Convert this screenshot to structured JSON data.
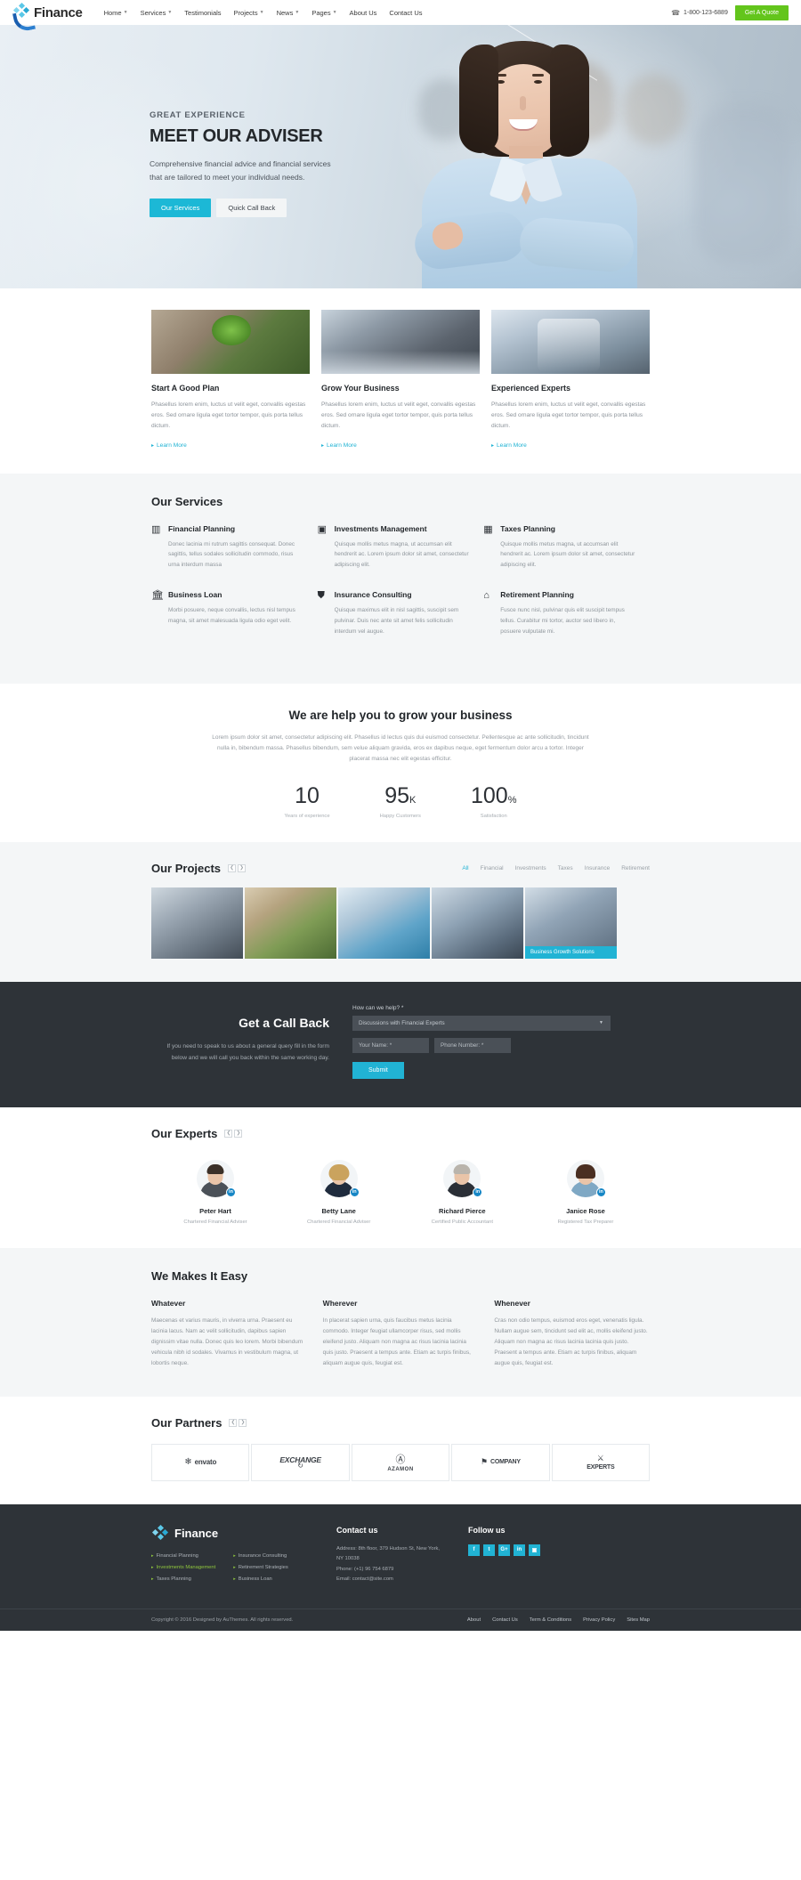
{
  "header": {
    "logo_text": "Finance",
    "nav": [
      {
        "label": "Home",
        "has_caret": true
      },
      {
        "label": "Services",
        "has_caret": true
      },
      {
        "label": "Testimonials",
        "has_caret": false
      },
      {
        "label": "Projects",
        "has_caret": true
      },
      {
        "label": "News",
        "has_caret": true
      },
      {
        "label": "Pages",
        "has_caret": true
      },
      {
        "label": "About Us",
        "has_caret": false
      },
      {
        "label": "Contact Us",
        "has_caret": false
      }
    ],
    "phone": "1-800-123-6889",
    "quote_button": "Get A Quote"
  },
  "hero": {
    "kicker": "GREAT EXPERIENCE",
    "title": "MEET OUR ADVISER",
    "subtitle": "Comprehensive financial advice and financial services that are tailored to meet your individual needs.",
    "primary_button": "Our Services",
    "secondary_button": "Quick Call Back"
  },
  "features": [
    {
      "title": "Start A Good Plan",
      "text": "Phasellus lorem enim, luctus ut velit eget, convallis egestas eros. Sed ornare ligula eget tortor tempor, quis porta tellus dictum.",
      "link": "Learn More"
    },
    {
      "title": "Grow Your Business",
      "text": "Phasellus lorem enim, luctus ut velit eget, convallis egestas eros. Sed ornare ligula eget tortor tempor, quis porta tellus dictum.",
      "link": "Learn More"
    },
    {
      "title": "Experienced Experts",
      "text": "Phasellus lorem enim, luctus ut velit eget, convallis egestas eros. Sed ornare ligula eget tortor tempor, quis porta tellus dictum.",
      "link": "Learn More"
    }
  ],
  "services": {
    "title": "Our Services",
    "items": [
      {
        "icon": "bar-chart-icon",
        "glyph": "▥",
        "title": "Financial Planning",
        "text": "Donec lacinia mi rutrum sagittis consequat. Donec sagittis, tellus sodales sollicitudin commodo, risus urna interdum massa"
      },
      {
        "icon": "money-icon",
        "glyph": "▣",
        "title": "Investments Management",
        "text": "Quisque mollis metus magna, ut accumsan elit hendrerit ac. Lorem ipsum dolor sit amet, consectetur adipiscing elit."
      },
      {
        "icon": "calculator-icon",
        "glyph": "▦",
        "title": "Taxes Planning",
        "text": "Quisque mollis metus magna, ut accumsan elit hendrerit ac. Lorem ipsum dolor sit amet, consectetur adipiscing elit."
      },
      {
        "icon": "bank-icon",
        "glyph": "🏛",
        "title": "Business Loan",
        "text": "Morbi posuere, neque convallis, lectus nisl tempus magna, sit amet malesuada ligula odio eget velit."
      },
      {
        "icon": "shield-icon",
        "glyph": "⛊",
        "title": "Insurance Consulting",
        "text": "Quisque maximus elit in nisl sagittis, suscipit sem pulvinar. Duis nec ante sit amet felis sollicitudin interdum vel augue."
      },
      {
        "icon": "home-icon",
        "glyph": "⌂",
        "title": "Retirement Planning",
        "text": "Fusce nunc nisl, pulvinar quis elit suscipit tempus tellus. Curabitur mi tortor, auctor sed libero in, posuere vulputate mi."
      }
    ]
  },
  "grow": {
    "title": "We are help you to grow your business",
    "text": "Lorem ipsum dolor sit amet, consectetur adipiscing elit. Phasellus id lectus quis dui euismod consectetur. Pellentesque ac ante sollicitudin, tincidunt nulla in, bibendum massa. Phasellus bibendum, sem velue aliquam gravida, eros ex dapibus neque, eget fermentum dolor arcu a tortor. Integer placerat massa nec elit egestas efficitur.",
    "counters": [
      {
        "value": "10",
        "suffix": "",
        "label": "Years of experience"
      },
      {
        "value": "95",
        "suffix": "K",
        "label": "Happy Customers"
      },
      {
        "value": "100",
        "suffix": "%",
        "label": "Satisfaction"
      }
    ]
  },
  "projects": {
    "title": "Our Projects",
    "filters": [
      "All",
      "Financial",
      "Investments",
      "Taxes",
      "Insurance",
      "Retirement"
    ],
    "active_filter": "All",
    "items": [
      {
        "label": ""
      },
      {
        "label": ""
      },
      {
        "label": ""
      },
      {
        "label": ""
      },
      {
        "label": "Business Growth Solutions"
      }
    ]
  },
  "callback": {
    "title": "Get a Call Back",
    "text": "If you need to speak to us about a general query fill in the form below and we will call you back within the same working day.",
    "select_label": "How can we help? *",
    "select_value": "Discussions with Financial Experts",
    "name_placeholder": "Your Name: *",
    "phone_placeholder": "Phone Number: *",
    "submit_label": "Submit"
  },
  "experts": {
    "title": "Our Experts",
    "items": [
      {
        "name": "Peter Hart",
        "role": "Chartered Financial Adviser",
        "hair": "#3b3028",
        "suit": "#4b5158"
      },
      {
        "name": "Betty Lane",
        "role": "Chartered Financial Adviser",
        "hair": "#caa35e",
        "suit": "#1f2b3d"
      },
      {
        "name": "Richard Pierce",
        "role": "Certified Public Accountant",
        "hair": "#b9b4ac",
        "suit": "#2a2f36"
      },
      {
        "name": "Janice Rose",
        "role": "Registered Tax Preparer",
        "hair": "#4a2f22",
        "suit": "#7fa8c4"
      }
    ]
  },
  "easy": {
    "title": "We Makes It Easy",
    "columns": [
      {
        "heading": "Whatever",
        "text": "Maecenas et varius mauris, in viverra urna. Praesent eu lacinia lacus. Nam ac velit sollicitudin, dapibus sapien dignissim vitae nulla. Donec quis leo lorem. Morbi bibendum vehicula nibh id sodales. Vivamus in vestibulum magna, ut lobortis neque."
      },
      {
        "heading": "Wherever",
        "text": "In placerat sapien urna, quis faucibus metus lacinia commodo. Integer feugiat ullamcorper risus, sed mollis eleifend justo. Aliquam non magna ac risus lacinia lacinia quis justo. Praesent a tempus ante. Etiam ac turpis finibus, aliquam augue quis, feugiat est."
      },
      {
        "heading": "Whenever",
        "text": "Cras non odio tempus, euismod eros eget, venenatis ligula. Nullam augue sem, tincidunt sed elit ac, mollis eleifend justo. Aliquam non magna ac risus lacinia lacinia quis justo. Praesent a tempus ante. Etiam ac turpis finibus, aliquam augue quis, feugiat est."
      }
    ]
  },
  "partners": {
    "title": "Our Partners",
    "items": [
      {
        "name": "envato",
        "icon": "e-leaf-icon",
        "style": "plain"
      },
      {
        "name": "EXCHANGE",
        "icon": "circle-arrows-icon",
        "style": "script"
      },
      {
        "name": "AZAMON",
        "icon": "a-badge-icon",
        "style": "plain"
      },
      {
        "name": "COMPANY",
        "icon": "flag-icon",
        "style": "plain"
      },
      {
        "name": "EXPERTS",
        "icon": "crossed-tools-icon",
        "style": "plain"
      }
    ]
  },
  "footer": {
    "logo_text": "Finance",
    "links_col1": [
      {
        "label": "Financial Planning",
        "accent": false
      },
      {
        "label": "Investments Management",
        "accent": true
      },
      {
        "label": "Taxes Planning",
        "accent": false
      }
    ],
    "links_col2": [
      {
        "label": "Insurance Consulting",
        "accent": false
      },
      {
        "label": "Retirement Strategies",
        "accent": false
      },
      {
        "label": "Business Loan",
        "accent": false
      }
    ],
    "contact_heading": "Contact us",
    "contact_address": "Address: 8th floor, 379 Hudson St, New York, NY 10038",
    "contact_phone": "Phone: (+1) 96 754 6879",
    "contact_email": "Email: contact@site.com",
    "follow_heading": "Follow us",
    "socials": [
      {
        "name": "facebook-icon",
        "glyph": "f"
      },
      {
        "name": "twitter-icon",
        "glyph": "t"
      },
      {
        "name": "google-plus-icon",
        "glyph": "G+"
      },
      {
        "name": "linkedin-icon",
        "glyph": "in"
      },
      {
        "name": "instagram-icon",
        "glyph": "▣"
      }
    ],
    "copyright": "Copyright © 2016 Designed by AuThemes. All rights reserved.",
    "bottom_links": [
      "About",
      "Contact Us",
      "Term & Conditions",
      "Privacy Policy",
      "Sites Map"
    ]
  },
  "colors": {
    "accent": "#21b3d4",
    "green": "#63c51c",
    "dark": "#2e3338",
    "light_gray": "#f4f6f7"
  }
}
